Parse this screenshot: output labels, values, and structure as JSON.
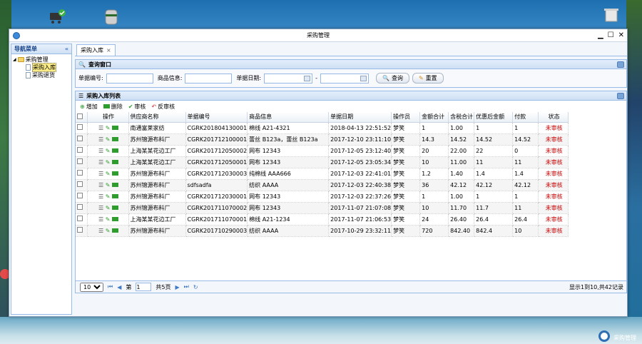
{
  "window": {
    "title": "采购管理"
  },
  "nav": {
    "header": "导航菜单",
    "collapse": "«",
    "root": "采购管理",
    "items": [
      {
        "label": "采购入库"
      },
      {
        "label": "采购退货"
      }
    ]
  },
  "tab": {
    "label": "采购入库",
    "close": "×"
  },
  "query_panel": {
    "title": "查询窗口",
    "f1": "单据编号:",
    "f2": "商品信息:",
    "f3": "单据日期:",
    "dash": "-",
    "search": "查询",
    "reset": "重置"
  },
  "list_panel": {
    "title": "采购入库列表"
  },
  "toolbar": {
    "add": "增加",
    "delete": "删除",
    "audit": "审核",
    "unaudit": "反审核"
  },
  "table": {
    "columns": [
      "操作",
      "供应商名称",
      "单据编号",
      "商品信息",
      "单据日期",
      "操作员",
      "金额合计",
      "含税合计",
      "优惠后金额",
      "付款",
      "状态"
    ],
    "rows": [
      [
        "南通富莱家纺",
        "CGRK201804130001",
        "棉线 A21-4321",
        "2018-04-13 22:51:52",
        "梦笑",
        "1",
        "1.00",
        "1",
        "1",
        "未审核"
      ],
      [
        "苏州锦源布料厂",
        "CGRK201712100001",
        "蕾丝 B123a，蕾丝 B123a",
        "2017-12-10 23:11:10",
        "梦笑",
        "14.3",
        "14.52",
        "14.52",
        "14.52",
        "未审核"
      ],
      [
        "上海某某花边工厂",
        "CGRK201712050002",
        "网布 12343",
        "2017-12-05 23:12:40",
        "梦笑",
        "20",
        "22.00",
        "22",
        "0",
        "未审核"
      ],
      [
        "上海某某花边工厂",
        "CGRK201712050001",
        "网布 12343",
        "2017-12-05 23:05:34",
        "梦笑",
        "10",
        "11.00",
        "11",
        "11",
        "未审核"
      ],
      [
        "苏州锦源布料厂",
        "CGRK201712030003",
        "纯棉线 AAA666",
        "2017-12-03 22:41:01",
        "梦笑",
        "1.2",
        "1.40",
        "1.4",
        "1.4",
        "未审核"
      ],
      [
        "苏州锦源布料厂",
        "sdfsadfa",
        "纺织 AAAA",
        "2017-12-03 22:40:38",
        "梦笑",
        "36",
        "42.12",
        "42.12",
        "42.12",
        "未审核"
      ],
      [
        "苏州锦源布料厂",
        "CGRK201712030001",
        "网布 12343",
        "2017-12-03 22:37:26",
        "梦笑",
        "1",
        "1.00",
        "1",
        "1",
        "未审核"
      ],
      [
        "苏州锦源布料厂",
        "CGRK201711070002",
        "网布 12343",
        "2017-11-07 21:07:08",
        "梦笑",
        "10",
        "11.70",
        "11.7",
        "11",
        "未审核"
      ],
      [
        "上海某某花边工厂",
        "CGRK201711070001",
        "棉线 A21-1234",
        "2017-11-07 21:06:53",
        "梦笑",
        "24",
        "26.40",
        "26.4",
        "26.4",
        "未审核"
      ],
      [
        "苏州锦源布料厂",
        "CGRK201710290003",
        "纺织 AAAA",
        "2017-10-29 23:32:11",
        "梦笑",
        "720",
        "842.40",
        "842.4",
        "10",
        "未审核"
      ]
    ]
  },
  "pager": {
    "page_size": "10",
    "page_prefix": "第",
    "page": "1",
    "page_suffix": "共5页",
    "summary": "显示1到10,共42记录"
  },
  "desktop": {
    "bottom_right_label": "采购管理"
  },
  "colors": {
    "accent": "#99bbe8",
    "status_red": "#cc0000"
  }
}
